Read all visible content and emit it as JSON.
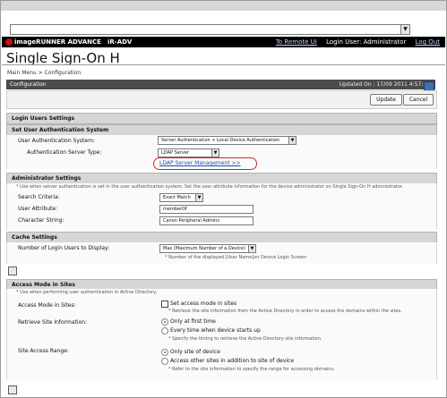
{
  "top": {
    "select_value": ""
  },
  "header": {
    "product": "imageRUNNER ADVANCE",
    "model": "iR-ADV",
    "links": {
      "remote": "To Remote UI",
      "user": "Login User: Administrator",
      "logout": "Log Out"
    }
  },
  "page": {
    "title": "Single Sign-On H",
    "breadcrumb": "Main Menu > Configuration"
  },
  "config": {
    "label": "Configuration",
    "updated": "Updated On : 17/09 2011 4:57:36"
  },
  "buttons": {
    "update": "Update",
    "cancel": "Cancel"
  },
  "login_users": {
    "section": "Login Users Settings",
    "user_auth_system_section": "Set User Authentication System",
    "user_auth_system_label": "User Authentication System:",
    "user_auth_system_value": "Server Authentication + Local Device Authentication",
    "auth_server_type_label": "Authentication Server Type:",
    "auth_server_type_value": "LDAP Server",
    "ldap_link": "LDAP Server Management >>"
  },
  "admin_settings": {
    "section": "Administrator Settings",
    "note": "* Use when server authentication is set in the user authentication system. Set the user attribute information for the device administrator on Single Sign-On H administrator.",
    "search_label": "Search Criteria:",
    "search_value": "Exact Match",
    "attr_label": "User Attribute:",
    "attr_value": "memberOf",
    "char_label": "Character String:",
    "char_value": "Canon Peripheral Admins"
  },
  "cache_settings": {
    "section": "Cache Settings",
    "num_label": "Number of Login Users to Display:",
    "num_value": "Max (Maximum Number of a Device)",
    "num_note": "* Number of the displayed [User Name]on Device Login Screen"
  },
  "ad_sites": {
    "section": "Access Mode in Sites",
    "note": "* Use when performing user authentication in Active Directory.",
    "access_label": "Access Mode in Sites:",
    "access_check": "Set access mode in sites",
    "access_note": "* Retrieve the site information from the Active Directory in order to access the domains within the sites.",
    "retrieve_label": "Retrieve Site Information:",
    "retrieve_opt1": "Only at first time",
    "retrieve_opt2": "Every time when device starts up",
    "retrieve_note": "* Specify the timing to retrieve the Active Directory site information.",
    "range_label": "Site Access Range:",
    "range_opt1": "Only site of device",
    "range_opt2": "Access other sites in addition to site of device",
    "range_note": "* Refer to the site information to specify the range for accessing domains."
  },
  "colors": {
    "header_bg": "#000000",
    "config_bg": "#4b4b4b",
    "section_bg": "#d6d6d6",
    "link_blue": "#1e4fb8",
    "highlight_red": "#d12a2a",
    "logo_red": "#c21212"
  },
  "icons": {
    "logo": "canon-logo-icon",
    "refresh": "refresh-icon",
    "collapse": "collapse-icon",
    "dropdown": "chevron-down-icon"
  }
}
